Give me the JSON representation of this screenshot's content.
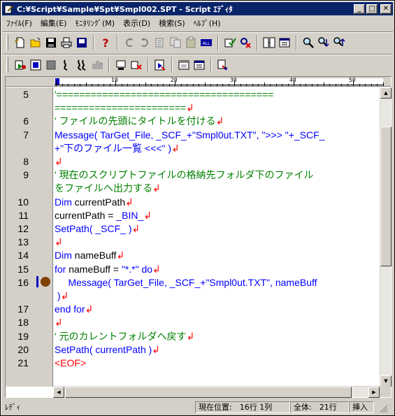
{
  "window": {
    "title": "C:¥Script¥Sample¥Spt¥Smpl002.SPT - Script ｴﾃﾞｨﾀ",
    "btn_min": "_",
    "btn_max": "□",
    "btn_close": "✕"
  },
  "menu": [
    "ﾌｧｲﾙ(F)",
    "編集(E)",
    "ﾓﾆﾀﾘﾝｸﾞ(M)",
    "表示(D)",
    "検索(S)",
    "ﾍﾙﾌﾟ(H)"
  ],
  "toolbar1": [
    "new-file-icon",
    "open-file-icon",
    "save-icon",
    "print-icon",
    "save-all-icon",
    "help-icon",
    "undo-icon",
    "redo-icon",
    "cut-icon",
    "copy-icon",
    "paste-icon",
    "select-all-icon",
    "check-icon",
    "delete-icon",
    "find-icon",
    "replace-icon",
    "search-icon",
    "search-next-icon",
    "search-prev-icon"
  ],
  "toolbar2": [
    "run-step-icon",
    "run-icon",
    "stop-icon",
    "trace-icon",
    "trace-all-icon",
    "breakpoint-list-icon",
    "monitor-icon",
    "clear-break-icon",
    "jump-icon",
    "window1-icon",
    "window2-icon",
    "settings-icon"
  ],
  "ruler": {
    "labels": [
      "10",
      "20",
      "30",
      "40",
      "50"
    ]
  },
  "editor": {
    "line_numbers": [
      "5",
      "",
      "6",
      "7",
      "",
      "8",
      "9",
      "",
      "10",
      "11",
      "12",
      "13",
      "14",
      "15",
      "16",
      "",
      "17",
      "18",
      "19",
      "20",
      "21"
    ],
    "lines": [
      {
        "text": "'======================================",
        "color": "green"
      },
      {
        "text": "=======================",
        "color": "green",
        "cr": true
      },
      {
        "text": "' ファイルの先頭にタイトルを付ける",
        "color": "green",
        "cr": true
      },
      {
        "text": "Message( TarGet_File, _SCF_+\"Smpl0ut.TXT\", \">>> \"+_SCF_",
        "color": "blue"
      },
      {
        "text": "+\"下のファイル一覧 <<<\" )",
        "color": "blue",
        "cr": true
      },
      {
        "text": "",
        "color": "black",
        "cr": true
      },
      {
        "text": "' 現在のスクリプトファイルの格納先フォルダ下のファイル",
        "color": "green"
      },
      {
        "text": "をファイルへ出力する",
        "color": "green",
        "cr": true
      },
      {
        "text": "Dim currentPath",
        "color": "mixed1",
        "cr": true
      },
      {
        "text": "currentPath = _BIN_",
        "color": "mixed2",
        "cr": true
      },
      {
        "text": "SetPath( _SCF_ )",
        "color": "blue",
        "cr": true
      },
      {
        "text": "",
        "color": "black",
        "cr": true
      },
      {
        "text": "Dim nameBuff",
        "color": "mixed1",
        "cr": true
      },
      {
        "text": "for nameBuff = \"*.*\" do",
        "color": "mixed3",
        "cr": true
      },
      {
        "text": "     Message( TarGet_File, _SCF_+\"Smpl0ut.TXT\", nameBuff",
        "color": "blue"
      },
      {
        "text": " )",
        "color": "blue",
        "cr": true
      },
      {
        "text": "end for",
        "color": "blue",
        "cr": true
      },
      {
        "text": "",
        "color": "black",
        "cr": true
      },
      {
        "text": "' 元のカレントフォルダへ戻す",
        "color": "green",
        "cr": true
      },
      {
        "text": "SetPath( currentPath )",
        "color": "blue",
        "cr": true
      },
      {
        "text": "<EOF>",
        "color": "red"
      }
    ],
    "cr_mark": "↲"
  },
  "status": {
    "ready": "ﾚﾃﾞｨ",
    "position": "現在位置:　16行 1列",
    "total": "全体:　21行",
    "mode": "挿入"
  },
  "colors": {
    "title_bar": "#0a246a",
    "green": "#008000",
    "blue": "#0000ff",
    "red": "#ff0000",
    "breakpoint": "#804000"
  }
}
